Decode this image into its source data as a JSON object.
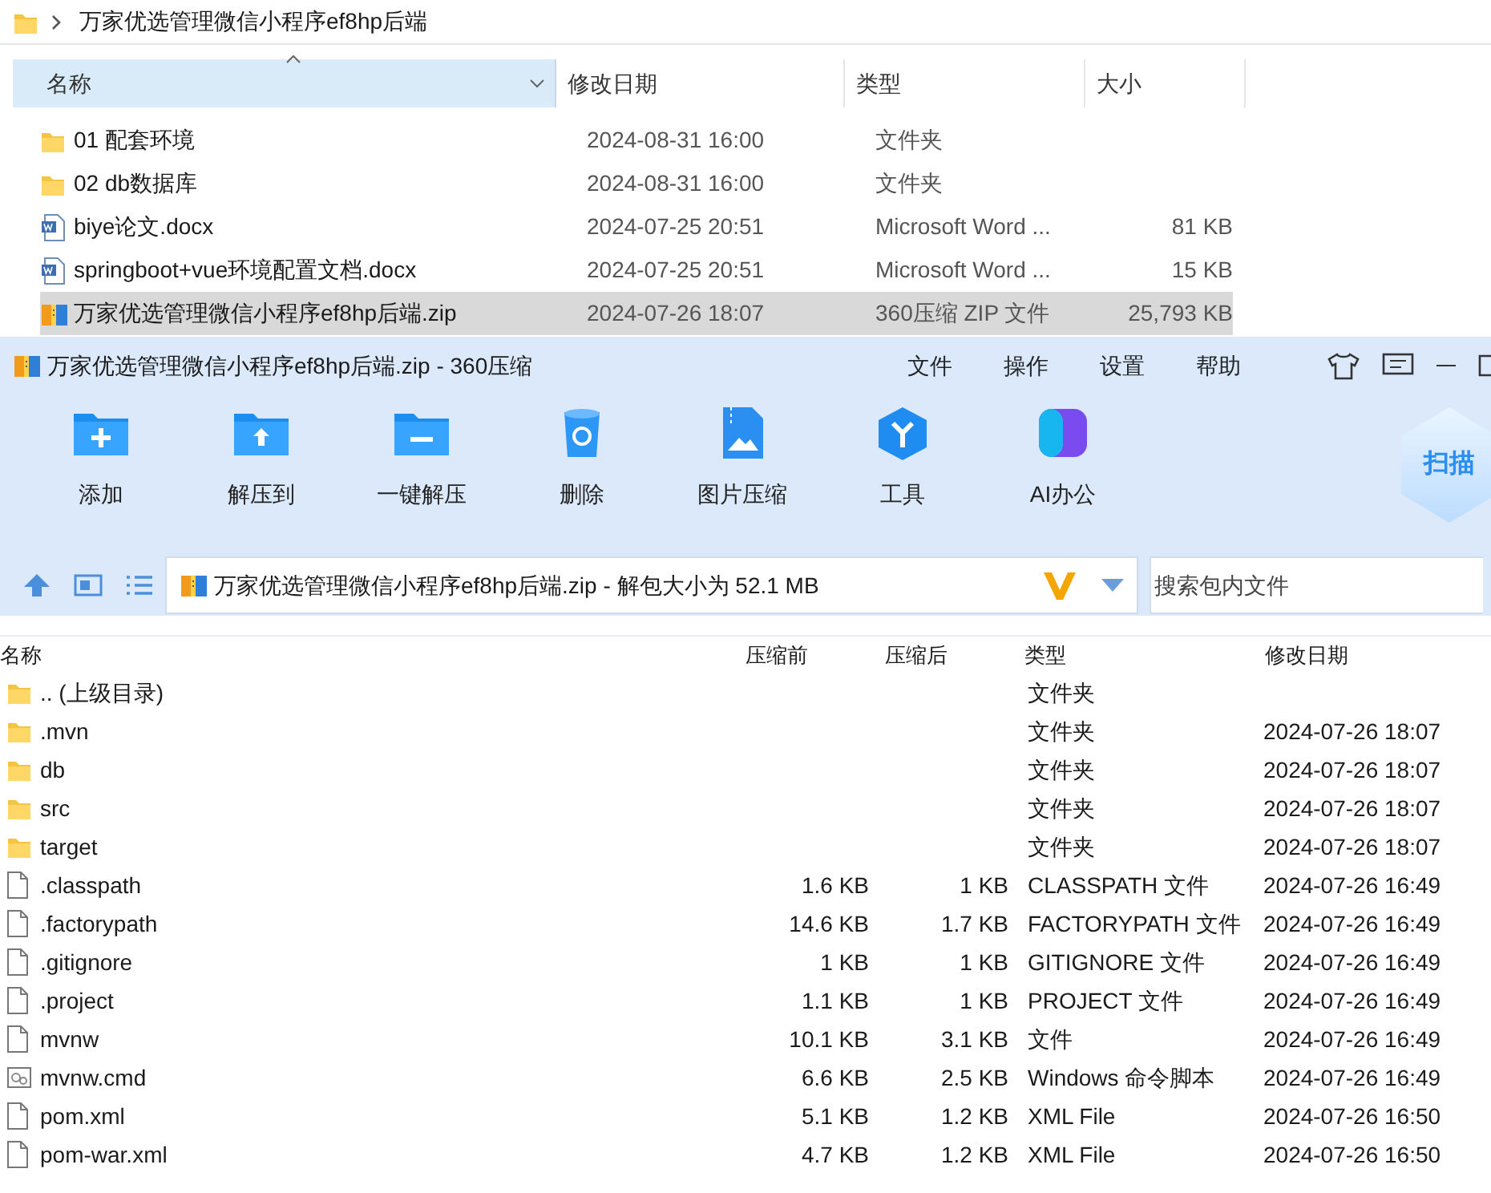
{
  "explorer": {
    "breadcrumb": "万家优选管理微信小程序ef8hp后端",
    "columns": [
      {
        "label": "名称",
        "sorted": true
      },
      {
        "label": "修改日期",
        "sorted": false
      },
      {
        "label": "类型",
        "sorted": false
      },
      {
        "label": "大小",
        "sorted": false
      }
    ],
    "rows": [
      {
        "kind": "folder",
        "name": "01 配套环境",
        "date": "2024-08-31 16:00",
        "type": "文件夹",
        "selected": false
      },
      {
        "kind": "folder",
        "name": "02 db数据库",
        "date": "2024-08-31 16:00",
        "type": "文件夹",
        "selected": false
      },
      {
        "kind": "doc",
        "name": "biye论文.docx",
        "date": "2024-07-25 20:51",
        "type": "Microsoft Word ...",
        "size": "81 KB",
        "selected": false
      },
      {
        "kind": "doc",
        "name": "springboot+vue环境配置文档.docx",
        "date": "2024-07-25 20:51",
        "type": "Microsoft Word ...",
        "size": "15 KB",
        "selected": false
      },
      {
        "kind": "zip",
        "name": "万家优选管理微信小程序ef8hp后端.zip",
        "date": "2024-07-26 18:07",
        "type": "360压缩 ZIP 文件",
        "size": "25,793 KB",
        "selected": true
      }
    ]
  },
  "archive": {
    "title": "万家优选管理微信小程序ef8hp后端.zip - 360压缩",
    "menu": [
      "文件",
      "操作",
      "设置",
      "帮助"
    ],
    "toolbar": [
      {
        "kind": "add",
        "label": "添加"
      },
      {
        "kind": "extract_to",
        "label": "解压到"
      },
      {
        "kind": "extract",
        "label": "一键解压"
      },
      {
        "kind": "delete",
        "label": "删除"
      },
      {
        "kind": "image",
        "label": "图片压缩"
      },
      {
        "kind": "tools",
        "label": "工具"
      },
      {
        "kind": "ai",
        "label": "AI办公"
      }
    ],
    "scan_badge": "扫描",
    "path": "万家优选管理微信小程序ef8hp后端.zip - 解包大小为 52.1 MB",
    "search": {
      "placeholder": "搜索包内文件"
    },
    "columns": [
      "名称",
      "压缩前",
      "压缩后",
      "类型",
      "修改日期"
    ],
    "rows": [
      {
        "kind": "folder",
        "name": ".. (上级目录)",
        "type": "文件夹"
      },
      {
        "kind": "folder",
        "name": ".mvn",
        "type": "文件夹",
        "date": "2024-07-26 18:07"
      },
      {
        "kind": "folder",
        "name": "db",
        "type": "文件夹",
        "date": "2024-07-26 18:07"
      },
      {
        "kind": "folder",
        "name": "src",
        "type": "文件夹",
        "date": "2024-07-26 18:07"
      },
      {
        "kind": "folder",
        "name": "target",
        "type": "文件夹",
        "date": "2024-07-26 18:07"
      },
      {
        "kind": "file",
        "name": ".classpath",
        "before": "1.6 KB",
        "after": "1 KB",
        "type": "CLASSPATH 文件",
        "date": "2024-07-26 16:49"
      },
      {
        "kind": "file",
        "name": ".factorypath",
        "before": "14.6 KB",
        "after": "1.7 KB",
        "type": "FACTORYPATH 文件",
        "date": "2024-07-26 16:49"
      },
      {
        "kind": "file",
        "name": ".gitignore",
        "before": "1 KB",
        "after": "1 KB",
        "type": "GITIGNORE 文件",
        "date": "2024-07-26 16:49"
      },
      {
        "kind": "file",
        "name": ".project",
        "before": "1.1 KB",
        "after": "1 KB",
        "type": "PROJECT 文件",
        "date": "2024-07-26 16:49"
      },
      {
        "kind": "file",
        "name": "mvnw",
        "before": "10.1 KB",
        "after": "3.1 KB",
        "type": "文件",
        "date": "2024-07-26 16:49"
      },
      {
        "kind": "script",
        "name": "mvnw.cmd",
        "before": "6.6 KB",
        "after": "2.5 KB",
        "type": "Windows 命令脚本",
        "date": "2024-07-26 16:49"
      },
      {
        "kind": "file",
        "name": "pom.xml",
        "before": "5.1 KB",
        "after": "1.2 KB",
        "type": "XML File",
        "date": "2024-07-26 16:50"
      },
      {
        "kind": "file",
        "name": "pom-war.xml",
        "before": "4.7 KB",
        "after": "1.2 KB",
        "type": "XML File",
        "date": "2024-07-26 16:50"
      }
    ]
  }
}
